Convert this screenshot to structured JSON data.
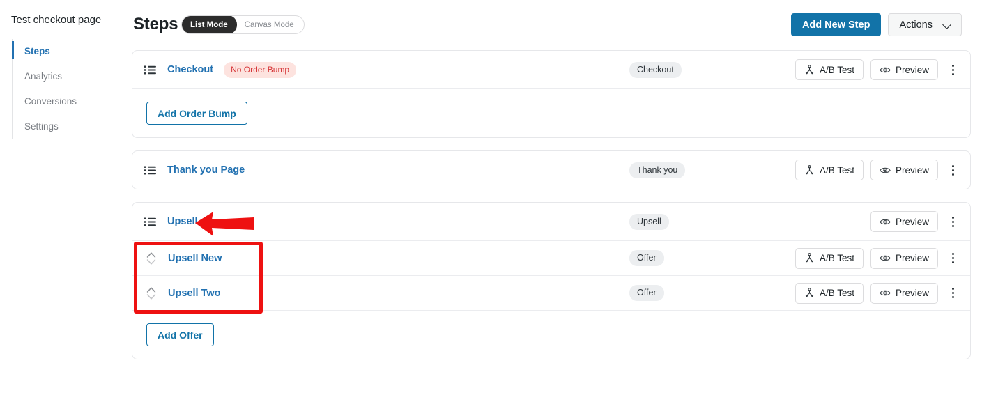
{
  "sidebar": {
    "title": "Test checkout page",
    "items": [
      {
        "label": "Steps",
        "active": true
      },
      {
        "label": "Analytics",
        "active": false
      },
      {
        "label": "Conversions",
        "active": false
      },
      {
        "label": "Settings",
        "active": false
      }
    ]
  },
  "header": {
    "title": "Steps",
    "mode_active": "List Mode",
    "mode_inactive": "Canvas Mode",
    "add_new_step": "Add New Step",
    "actions": "Actions"
  },
  "labels": {
    "ab_test": "A/B Test",
    "preview": "Preview",
    "add_order_bump": "Add Order Bump",
    "add_offer": "Add Offer"
  },
  "cards": [
    {
      "rows": [
        {
          "label": "Checkout",
          "warn_badge": "No Order Bump",
          "type_badge": "Checkout",
          "has_ab_test": true,
          "has_preview": true
        }
      ],
      "footer_button": "Add Order Bump"
    },
    {
      "rows": [
        {
          "label": "Thank you Page",
          "warn_badge": "",
          "type_badge": "Thank you",
          "has_ab_test": true,
          "has_preview": true
        }
      ],
      "footer_button": ""
    },
    {
      "rows": [
        {
          "label": "Upsell",
          "warn_badge": "",
          "type_badge": "Upsell",
          "has_ab_test": false,
          "has_preview": true
        }
      ],
      "subrows": [
        {
          "label": "Upsell New",
          "type_badge": "Offer",
          "has_ab_test": true,
          "has_preview": true
        },
        {
          "label": "Upsell Two",
          "type_badge": "Offer",
          "has_ab_test": true,
          "has_preview": true
        }
      ],
      "footer_button": "Add Offer"
    }
  ],
  "colors": {
    "accent": "#2271b1",
    "primary_button": "#1273a8",
    "warn_badge_bg": "#fde3df",
    "warn_badge_text": "#d63638",
    "type_badge_bg": "#eceef0",
    "annotation": "#ee1111",
    "toggle_active_bg": "#2c2c2c"
  },
  "annotations": {
    "arrow": "red-left-arrow",
    "box": "red-highlight-rectangle"
  }
}
